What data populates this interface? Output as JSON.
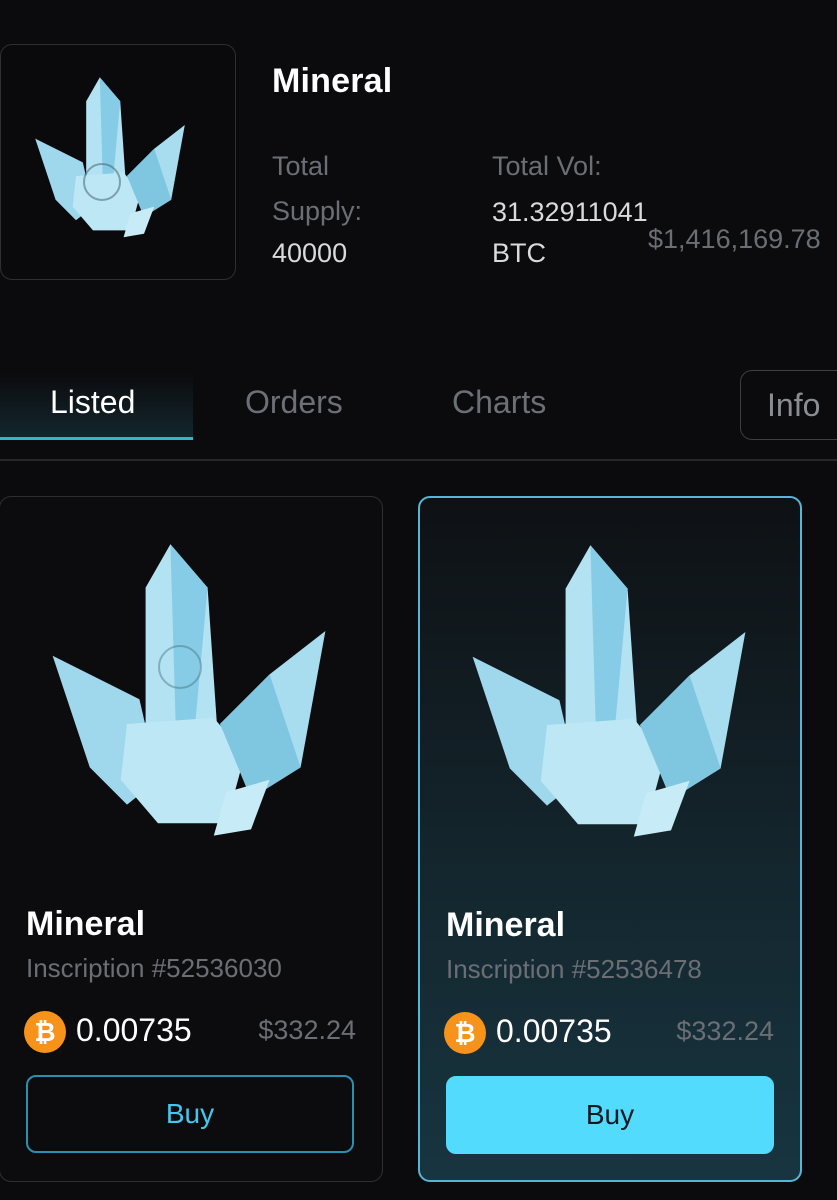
{
  "collection": {
    "title": "Mineral",
    "total_supply_label_1": "Total",
    "total_supply_label_2": "Supply:",
    "total_supply_value": "40000",
    "total_vol_label": "Total Vol:",
    "total_vol_btc_1": "31.32911041",
    "total_vol_btc_2": "BTC",
    "total_vol_usd": "$1,416,169.78"
  },
  "tabs": [
    {
      "label": "Listed",
      "active": true
    },
    {
      "label": "Orders",
      "active": false
    },
    {
      "label": "Charts",
      "active": false
    }
  ],
  "info_button": "Info",
  "listings": [
    {
      "title": "Mineral",
      "inscription": "Inscription #52536030",
      "price_btc": "0.00735",
      "price_usd": "$332.24",
      "buy_label": "Buy",
      "selected": false
    },
    {
      "title": "Mineral",
      "inscription": "Inscription #52536478",
      "price_btc": "0.00735",
      "price_usd": "$332.24",
      "buy_label": "Buy",
      "selected": true
    }
  ],
  "icons": {
    "crystal": "crystal-icon",
    "btc": "bitcoin-icon",
    "touch": "touch-hand-icon"
  },
  "colors": {
    "accent": "#52dbfd",
    "btc": "#f7931a",
    "crystal": "#a9dcee"
  }
}
